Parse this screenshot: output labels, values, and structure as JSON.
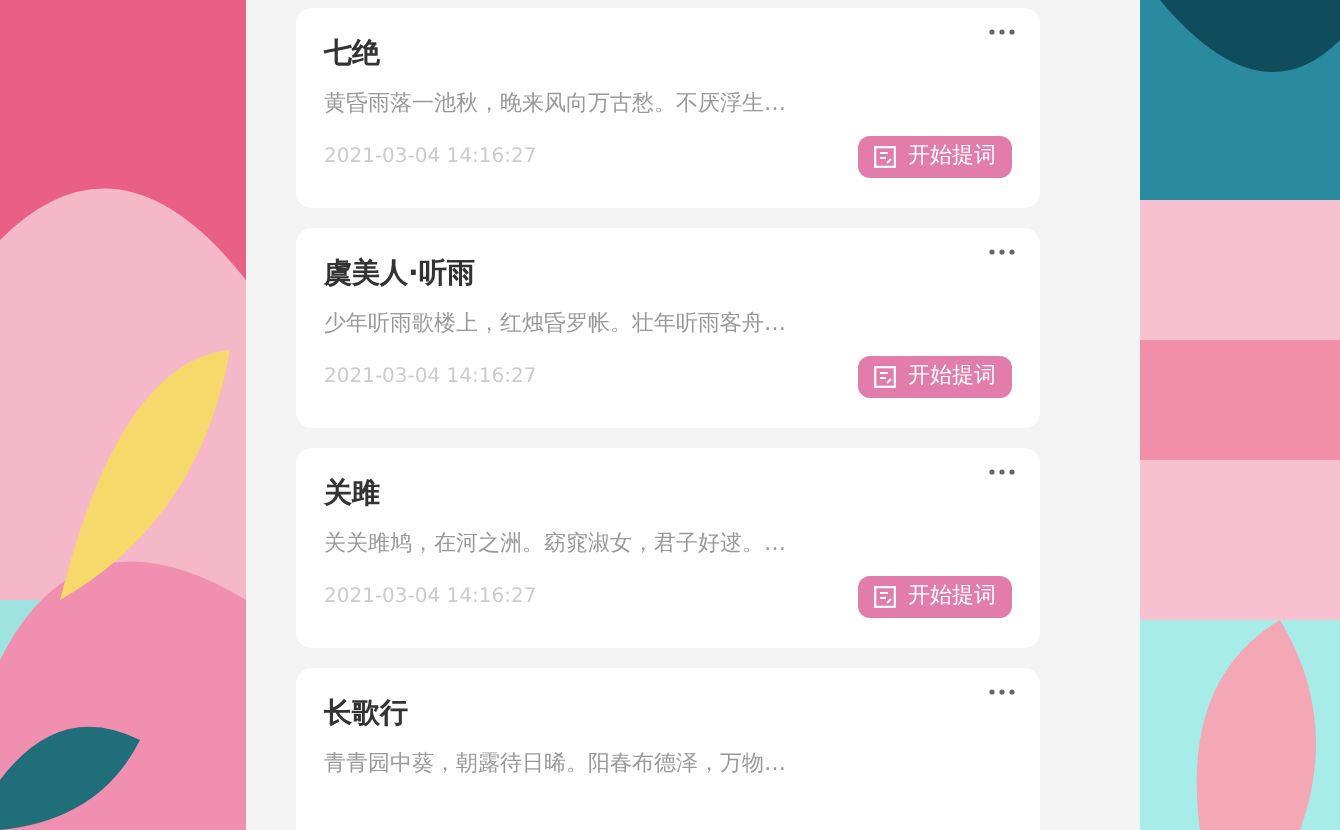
{
  "poems": [
    {
      "title": "七绝",
      "excerpt": "黄昏雨落一池秋，晚来风向万古愁。不厌浮生…",
      "date": "2021-03-04  14:16:27",
      "button": "开始提词"
    },
    {
      "title": "虞美人·听雨",
      "excerpt": "少年听雨歌楼上，红烛昏罗帐。壮年听雨客舟…",
      "date": "2021-03-04  14:16:27",
      "button": "开始提词"
    },
    {
      "title": "关雎",
      "excerpt": "关关雎鸠，在河之洲。窈窕淑女，君子好逑。…",
      "date": "2021-03-04  14:16:27",
      "button": "开始提词"
    },
    {
      "title": "长歌行",
      "excerpt": "青青园中葵，朝露待日晞。阳春布德泽，万物…"
    }
  ]
}
